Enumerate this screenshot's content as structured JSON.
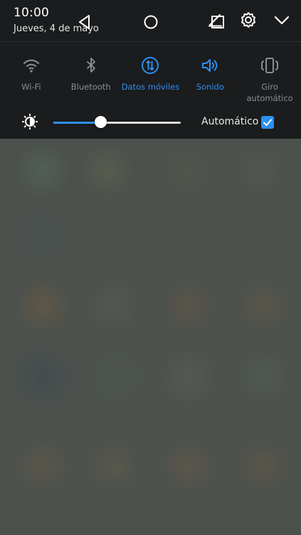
{
  "status": {
    "time": "10:00",
    "date": "Jueves, 4 de mayo"
  },
  "header_icons": [
    "edit-icon",
    "settings-icon",
    "collapse-chevron-icon"
  ],
  "tiles": [
    {
      "label": "Wi-Fi",
      "icon": "wifi-icon",
      "active": false
    },
    {
      "label": "Bluetooth",
      "icon": "bluetooth-icon",
      "active": false
    },
    {
      "label": "Datos móviles",
      "icon": "mobile-data-icon",
      "active": true
    },
    {
      "label": "Sonido",
      "icon": "sound-icon",
      "active": true
    },
    {
      "label": "Giro\nautomático",
      "label_line1": "Giro",
      "label_line2": "automático",
      "icon": "auto-rotate-icon",
      "active": false
    }
  ],
  "brightness": {
    "level": 0.37,
    "auto_label": "Automático",
    "auto_checked": true
  },
  "colors": {
    "accent": "#2e8ff0",
    "panel_bg": "#1a1c1d",
    "inactive_icon": "#8b8f92"
  },
  "navbar": [
    "back-icon",
    "home-icon",
    "recents-icon"
  ]
}
